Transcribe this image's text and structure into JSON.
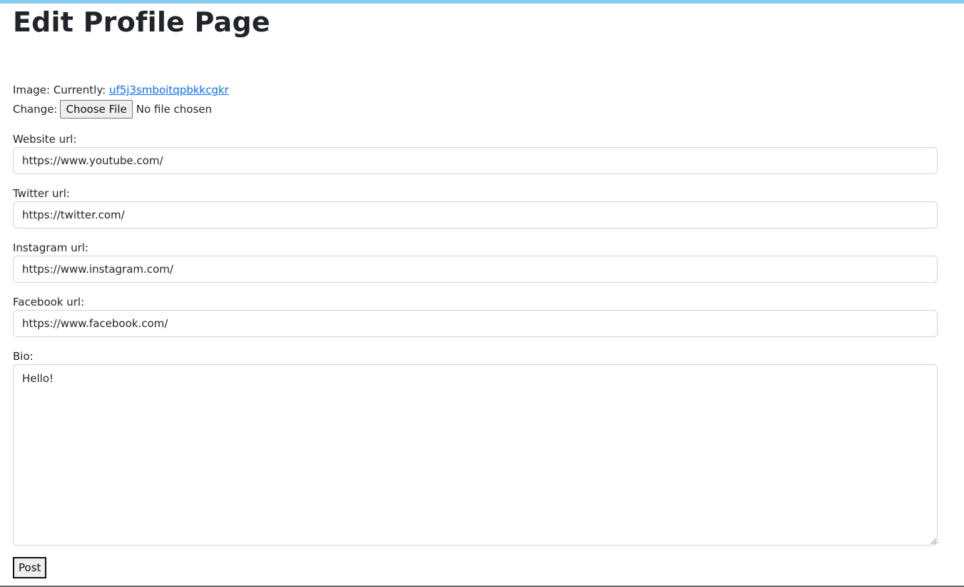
{
  "page": {
    "title": "Edit Profile Page"
  },
  "image": {
    "label": "Image:",
    "currently_label": "Currently:",
    "current_file": "uf5j3smboitqpbkkcgkr",
    "change_label": "Change:",
    "choose_file_label": "Choose File",
    "no_file_text": "No file chosen"
  },
  "fields": {
    "website": {
      "label": "Website url:",
      "value": "https://www.youtube.com/"
    },
    "twitter": {
      "label": "Twitter url:",
      "value": "https://twitter.com/"
    },
    "instagram": {
      "label": "Instagram url:",
      "value": "https://www.instagram.com/"
    },
    "facebook": {
      "label": "Facebook url:",
      "value": "https://www.facebook.com/"
    },
    "bio": {
      "label": "Bio:",
      "value": "Hello!"
    }
  },
  "actions": {
    "post_label": "Post"
  },
  "colors": {
    "accent_bar": "#8ccbf0",
    "link": "#0d6efd",
    "input_border": "#ced4da"
  }
}
